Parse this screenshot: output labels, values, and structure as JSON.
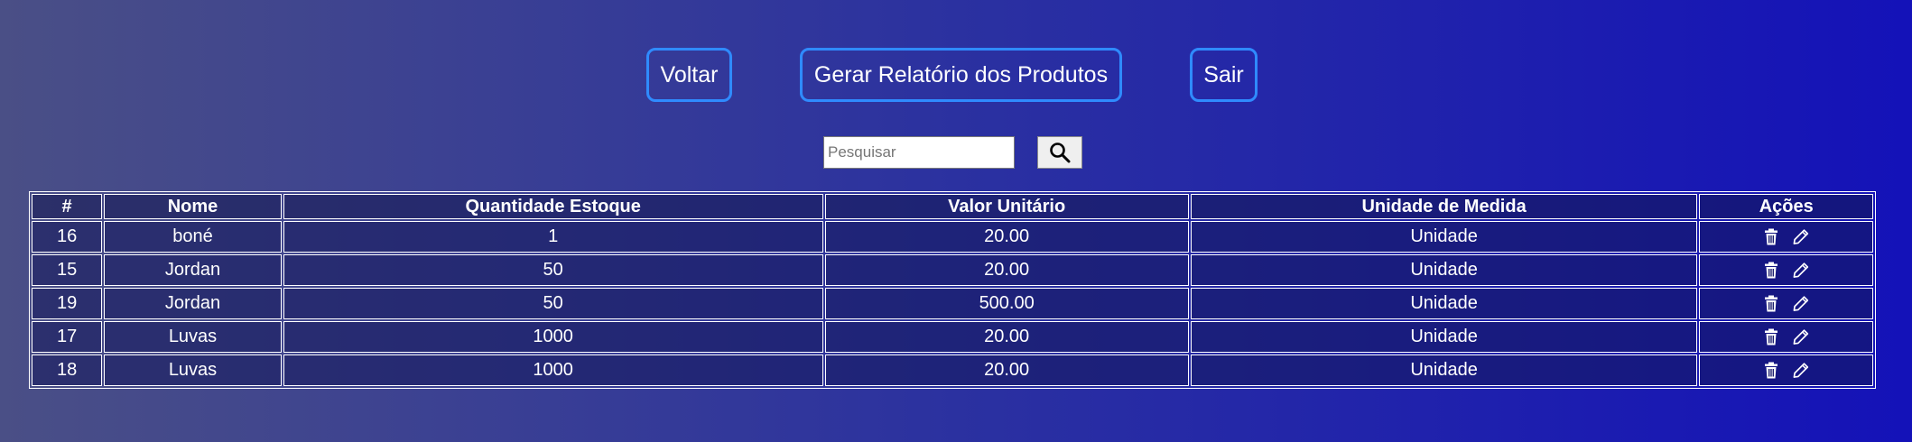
{
  "nav": {
    "back_label": "Voltar",
    "report_label": "Gerar Relatório dos Produtos",
    "exit_label": "Sair"
  },
  "search": {
    "placeholder": "Pesquisar",
    "value": "",
    "button_icon": "search-icon"
  },
  "table": {
    "headers": {
      "id": "#",
      "name": "Nome",
      "stock": "Quantidade Estoque",
      "price": "Valor Unitário",
      "unit": "Unidade de Medida",
      "actions": "Ações"
    },
    "rows": [
      {
        "id": "16",
        "name": "boné",
        "stock": "1",
        "price": "20.00",
        "unit": "Unidade"
      },
      {
        "id": "15",
        "name": "Jordan",
        "stock": "50",
        "price": "20.00",
        "unit": "Unidade"
      },
      {
        "id": "19",
        "name": "Jordan",
        "stock": "50",
        "price": "500.00",
        "unit": "Unidade"
      },
      {
        "id": "17",
        "name": "Luvas",
        "stock": "1000",
        "price": "20.00",
        "unit": "Unidade"
      },
      {
        "id": "18",
        "name": "Luvas",
        "stock": "1000",
        "price": "20.00",
        "unit": "Unidade"
      }
    ],
    "row_action_icons": [
      "trash-icon",
      "pencil-icon"
    ]
  },
  "colors": {
    "button_border": "#2f8bff",
    "background_start": "#4a4f86",
    "background_end": "#1412b8"
  }
}
